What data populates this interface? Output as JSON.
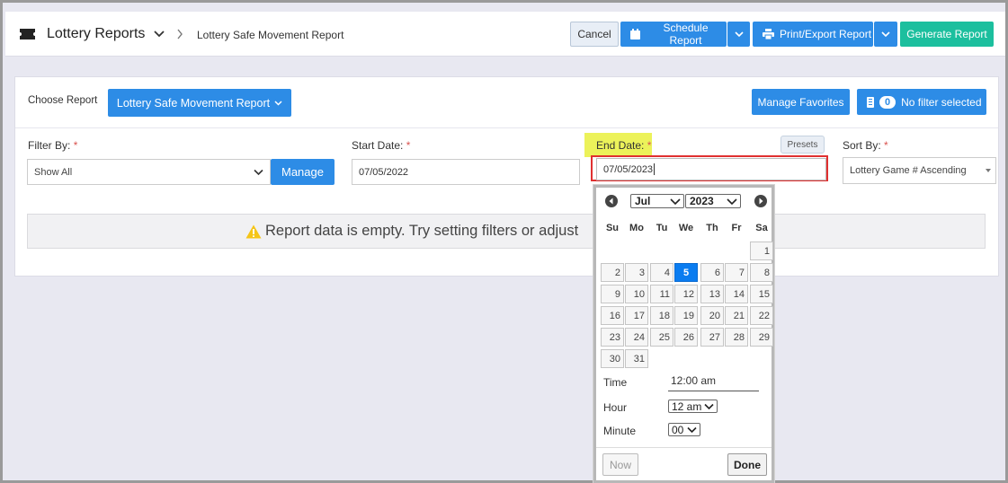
{
  "header": {
    "title": "Lottery Reports",
    "breadcrumb": "Lottery Safe Movement Report",
    "cancel_label": "Cancel",
    "schedule_label": "Schedule Report",
    "print_label": "Print/Export Report",
    "generate_label": "Generate Report"
  },
  "report": {
    "choose_label": "Choose Report",
    "selected_report": "Lottery Safe Movement Report",
    "manage_favorites_label": "Manage Favorites",
    "filter_count": "0",
    "filter_status": "No filter selected"
  },
  "filters": {
    "filter_by_label": "Filter By:",
    "filter_by_value": "Show All",
    "manage_label": "Manage",
    "start_date_label": "Start Date:",
    "start_date_value": "07/05/2022",
    "end_date_label": "End Date:",
    "end_date_value": "07/05/2023",
    "presets_label": "Presets",
    "sort_by_label": "Sort By:",
    "sort_by_value": "Lottery Game # Ascending",
    "required_mark": "*"
  },
  "alert": {
    "message": "Report data is empty. Try setting filters or adjust"
  },
  "datepicker": {
    "month": "Jul",
    "year": "2023",
    "weekdays": [
      "Su",
      "Mo",
      "Tu",
      "We",
      "Th",
      "Fr",
      "Sa"
    ],
    "days": [
      [
        "",
        "",
        "",
        "",
        "",
        "",
        "1"
      ],
      [
        "2",
        "3",
        "4",
        "5",
        "6",
        "7",
        "8"
      ],
      [
        "9",
        "10",
        "11",
        "12",
        "13",
        "14",
        "15"
      ],
      [
        "16",
        "17",
        "18",
        "19",
        "20",
        "21",
        "22"
      ],
      [
        "23",
        "24",
        "25",
        "26",
        "27",
        "28",
        "29"
      ],
      [
        "30",
        "31",
        "",
        "",
        "",
        "",
        ""
      ]
    ],
    "selected_day": "5",
    "time_label": "Time",
    "time_value": "12:00 am",
    "hour_label": "Hour",
    "hour_value": "12 am",
    "minute_label": "Minute",
    "minute_value": "00",
    "now_label": "Now",
    "done_label": "Done"
  },
  "colors": {
    "primary": "#2d8ce6",
    "success": "#1cbf9e",
    "required": "#d9534f",
    "highlight": "#ecf25a",
    "active_day": "#0a7cf0"
  }
}
